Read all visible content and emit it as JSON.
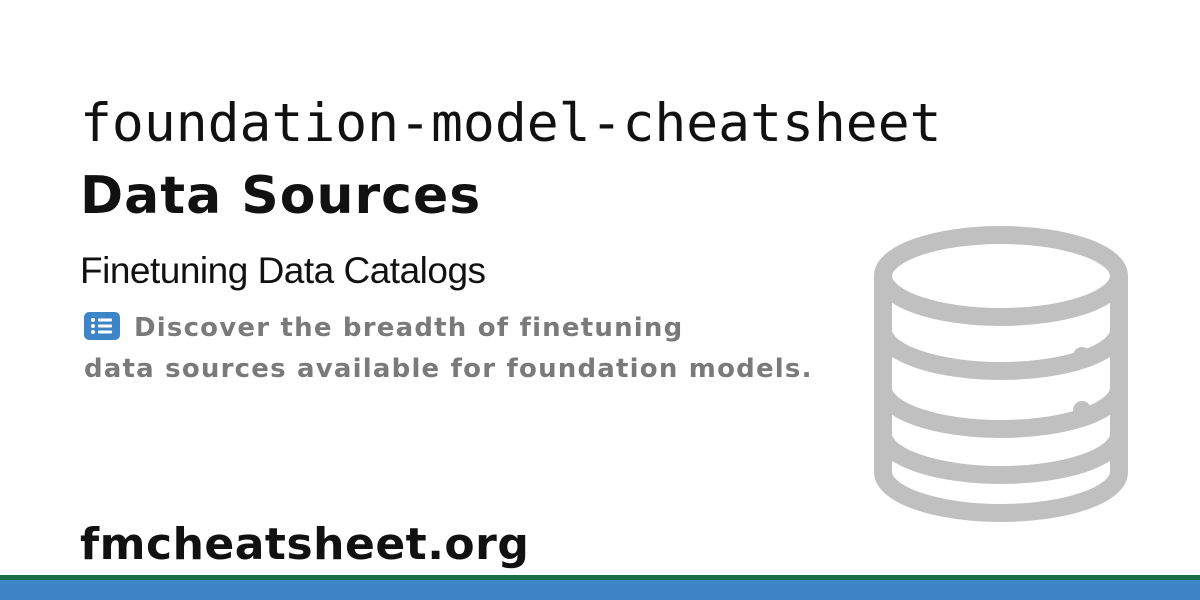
{
  "header": {
    "repo_name": "foundation-model-cheatsheet",
    "title": "Data Sources"
  },
  "content": {
    "subtitle": "Finetuning Data Catalogs",
    "description_line1": "Discover the breadth of finetuning",
    "description_line2": "data sources available for foundation models.",
    "description_icon": "list-icon"
  },
  "graphic": {
    "icon": "database-icon",
    "color": "#c0c0c0"
  },
  "footer": {
    "site_url": "fmcheatsheet.org"
  },
  "colors": {
    "background": "#ffffff",
    "text": "#111111",
    "description_text": "#7a7a7a",
    "list_icon": "#3d85c6",
    "footer_green": "#1a6e4a",
    "footer_blue": "#3d85c6"
  }
}
